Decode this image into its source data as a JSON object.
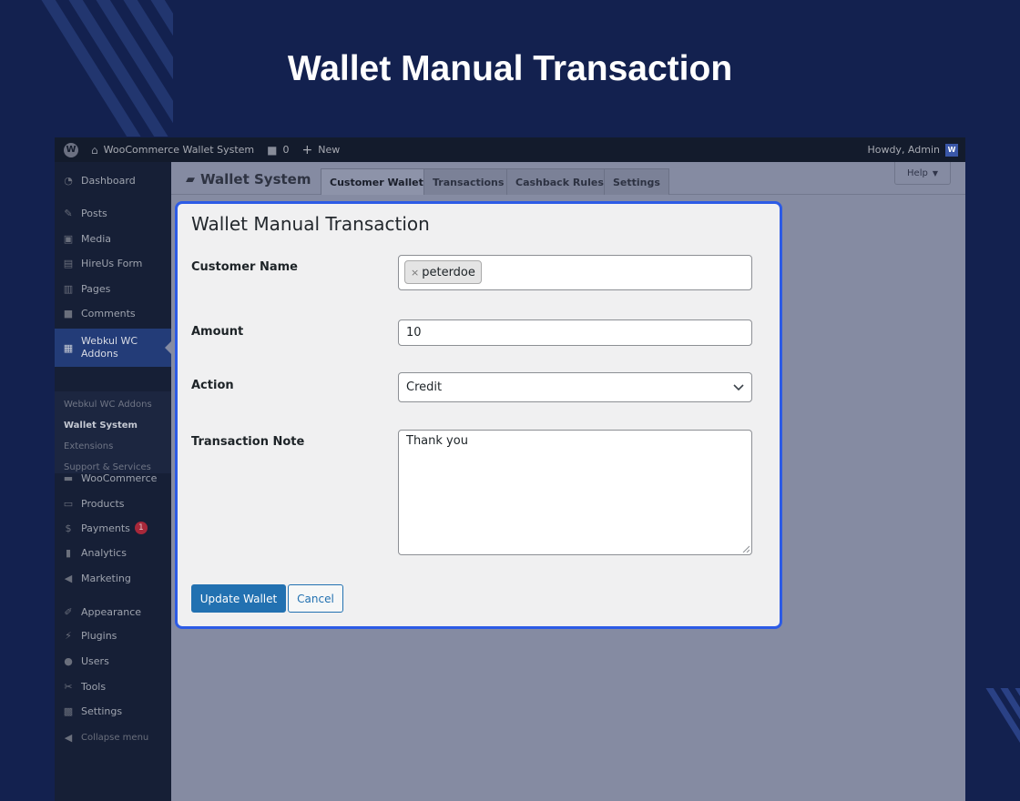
{
  "hero": {
    "title": "Wallet Manual Transaction"
  },
  "adminbar": {
    "site_name": "WooCommerce Wallet System",
    "comments_count": "0",
    "new_label": "New",
    "greeting": "Howdy, Admin",
    "avatar_letter": "W"
  },
  "sidebar": {
    "items": [
      {
        "label": "Dashboard",
        "icon": "dashboard-icon",
        "glyph": "◔"
      },
      {
        "label": "Posts",
        "icon": "pin-icon",
        "glyph": "✎"
      },
      {
        "label": "Media",
        "icon": "media-icon",
        "glyph": "▣"
      },
      {
        "label": "HireUs Form",
        "icon": "form-icon",
        "glyph": "▤"
      },
      {
        "label": "Pages",
        "icon": "pages-icon",
        "glyph": "▥"
      },
      {
        "label": "Comments",
        "icon": "comment-icon",
        "glyph": "■"
      },
      {
        "label": "Webkul WC Addons",
        "icon": "bag-icon",
        "glyph": "▦"
      },
      {
        "label": "WooCommerce",
        "icon": "woo-icon",
        "glyph": "▬"
      },
      {
        "label": "Products",
        "icon": "archive-icon",
        "glyph": "▭"
      },
      {
        "label": "Payments",
        "icon": "payment-icon",
        "glyph": "$",
        "badge": "1"
      },
      {
        "label": "Analytics",
        "icon": "chart-icon",
        "glyph": "▮"
      },
      {
        "label": "Marketing",
        "icon": "megaphone-icon",
        "glyph": "◀"
      },
      {
        "label": "Appearance",
        "icon": "brush-icon",
        "glyph": "✐"
      },
      {
        "label": "Plugins",
        "icon": "plugin-icon",
        "glyph": "⚡"
      },
      {
        "label": "Users",
        "icon": "user-icon",
        "glyph": "●"
      },
      {
        "label": "Tools",
        "icon": "wrench-icon",
        "glyph": "✂"
      },
      {
        "label": "Settings",
        "icon": "settings-icon",
        "glyph": "▩"
      }
    ],
    "submenu": [
      "Webkul WC Addons",
      "Wallet System",
      "Extensions",
      "Support & Services"
    ],
    "collapse_label": "Collapse menu"
  },
  "header": {
    "page_title": "Wallet System",
    "tabs": [
      "Customer Wallet",
      "Transactions",
      "Cashback Rules",
      "Settings"
    ],
    "help_label": "Help"
  },
  "modal": {
    "title": "Wallet Manual Transaction",
    "customer_label": "Customer Name",
    "customer_tag": "peterdoe",
    "amount_label": "Amount",
    "amount_value": "10",
    "action_label": "Action",
    "action_value": "Credit",
    "note_label": "Transaction Note",
    "note_value": "Thank you",
    "submit_label": "Update Wallet",
    "cancel_label": "Cancel"
  },
  "colors": {
    "page_bg": "#13214f",
    "modal_border": "#2c5be6",
    "primary": "#2271b1",
    "sidebar_active": "#233c78"
  }
}
